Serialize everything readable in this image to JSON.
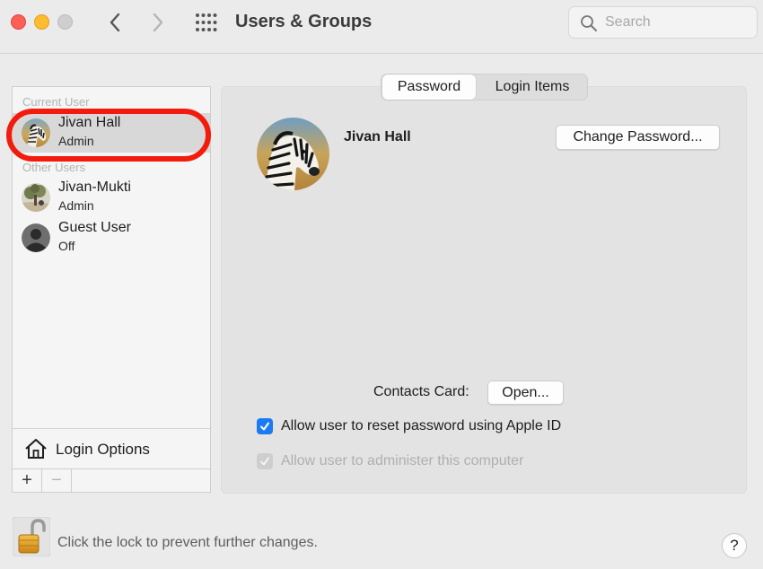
{
  "window": {
    "title": "Users & Groups"
  },
  "search": {
    "placeholder": "Search"
  },
  "sidebar": {
    "current_user_label": "Current User",
    "other_users_label": "Other Users",
    "users": [
      {
        "name": "Jivan Hall",
        "role": "Admin",
        "selected": true
      },
      {
        "name": "Jivan-Mukti",
        "role": "Admin",
        "selected": false
      },
      {
        "name": "Guest User",
        "role": "Off",
        "selected": false
      }
    ],
    "login_options_label": "Login Options",
    "add_label": "+",
    "remove_label": "−"
  },
  "tabs": [
    {
      "label": "Password",
      "active": true
    },
    {
      "label": "Login Items",
      "active": false
    }
  ],
  "main": {
    "user_name": "Jivan Hall",
    "change_password_label": "Change Password...",
    "contacts_card_label": "Contacts Card:",
    "open_label": "Open...",
    "allow_reset_label": "Allow user to reset password using Apple ID",
    "allow_reset_checked": true,
    "allow_admin_label": "Allow user to administer this computer",
    "allow_admin_checked": true,
    "allow_admin_enabled": false
  },
  "footer": {
    "lock_text": "Click the lock to prevent further changes.",
    "help_label": "?"
  },
  "colors": {
    "highlight": "#f21b0d",
    "checkbox_accent": "#1a7bf5",
    "close": "#fe5f57",
    "minimize": "#febc2e"
  },
  "icons": [
    "chevron-left-icon",
    "chevron-right-icon",
    "grid-icon",
    "search-icon",
    "house-icon",
    "lock-icon",
    "checkmark-icon"
  ]
}
